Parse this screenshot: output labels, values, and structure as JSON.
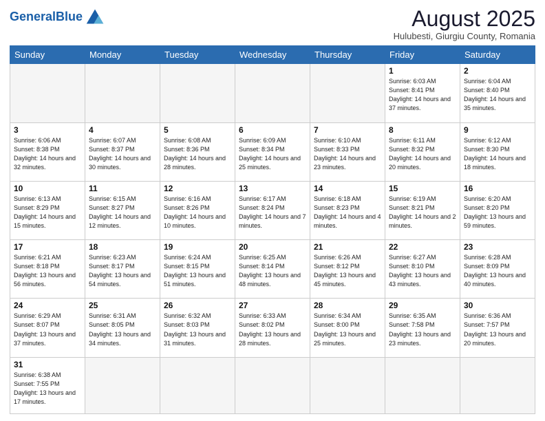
{
  "header": {
    "logo_general": "General",
    "logo_blue": "Blue",
    "month_year": "August 2025",
    "location": "Hulubesti, Giurgiu County, Romania"
  },
  "days_of_week": [
    "Sunday",
    "Monday",
    "Tuesday",
    "Wednesday",
    "Thursday",
    "Friday",
    "Saturday"
  ],
  "weeks": [
    [
      {
        "day": "",
        "info": ""
      },
      {
        "day": "",
        "info": ""
      },
      {
        "day": "",
        "info": ""
      },
      {
        "day": "",
        "info": ""
      },
      {
        "day": "",
        "info": ""
      },
      {
        "day": "1",
        "info": "Sunrise: 6:03 AM\nSunset: 8:41 PM\nDaylight: 14 hours and 37 minutes."
      },
      {
        "day": "2",
        "info": "Sunrise: 6:04 AM\nSunset: 8:40 PM\nDaylight: 14 hours and 35 minutes."
      }
    ],
    [
      {
        "day": "3",
        "info": "Sunrise: 6:06 AM\nSunset: 8:38 PM\nDaylight: 14 hours and 32 minutes."
      },
      {
        "day": "4",
        "info": "Sunrise: 6:07 AM\nSunset: 8:37 PM\nDaylight: 14 hours and 30 minutes."
      },
      {
        "day": "5",
        "info": "Sunrise: 6:08 AM\nSunset: 8:36 PM\nDaylight: 14 hours and 28 minutes."
      },
      {
        "day": "6",
        "info": "Sunrise: 6:09 AM\nSunset: 8:34 PM\nDaylight: 14 hours and 25 minutes."
      },
      {
        "day": "7",
        "info": "Sunrise: 6:10 AM\nSunset: 8:33 PM\nDaylight: 14 hours and 23 minutes."
      },
      {
        "day": "8",
        "info": "Sunrise: 6:11 AM\nSunset: 8:32 PM\nDaylight: 14 hours and 20 minutes."
      },
      {
        "day": "9",
        "info": "Sunrise: 6:12 AM\nSunset: 8:30 PM\nDaylight: 14 hours and 18 minutes."
      }
    ],
    [
      {
        "day": "10",
        "info": "Sunrise: 6:13 AM\nSunset: 8:29 PM\nDaylight: 14 hours and 15 minutes."
      },
      {
        "day": "11",
        "info": "Sunrise: 6:15 AM\nSunset: 8:27 PM\nDaylight: 14 hours and 12 minutes."
      },
      {
        "day": "12",
        "info": "Sunrise: 6:16 AM\nSunset: 8:26 PM\nDaylight: 14 hours and 10 minutes."
      },
      {
        "day": "13",
        "info": "Sunrise: 6:17 AM\nSunset: 8:24 PM\nDaylight: 14 hours and 7 minutes."
      },
      {
        "day": "14",
        "info": "Sunrise: 6:18 AM\nSunset: 8:23 PM\nDaylight: 14 hours and 4 minutes."
      },
      {
        "day": "15",
        "info": "Sunrise: 6:19 AM\nSunset: 8:21 PM\nDaylight: 14 hours and 2 minutes."
      },
      {
        "day": "16",
        "info": "Sunrise: 6:20 AM\nSunset: 8:20 PM\nDaylight: 13 hours and 59 minutes."
      }
    ],
    [
      {
        "day": "17",
        "info": "Sunrise: 6:21 AM\nSunset: 8:18 PM\nDaylight: 13 hours and 56 minutes."
      },
      {
        "day": "18",
        "info": "Sunrise: 6:23 AM\nSunset: 8:17 PM\nDaylight: 13 hours and 54 minutes."
      },
      {
        "day": "19",
        "info": "Sunrise: 6:24 AM\nSunset: 8:15 PM\nDaylight: 13 hours and 51 minutes."
      },
      {
        "day": "20",
        "info": "Sunrise: 6:25 AM\nSunset: 8:14 PM\nDaylight: 13 hours and 48 minutes."
      },
      {
        "day": "21",
        "info": "Sunrise: 6:26 AM\nSunset: 8:12 PM\nDaylight: 13 hours and 45 minutes."
      },
      {
        "day": "22",
        "info": "Sunrise: 6:27 AM\nSunset: 8:10 PM\nDaylight: 13 hours and 43 minutes."
      },
      {
        "day": "23",
        "info": "Sunrise: 6:28 AM\nSunset: 8:09 PM\nDaylight: 13 hours and 40 minutes."
      }
    ],
    [
      {
        "day": "24",
        "info": "Sunrise: 6:29 AM\nSunset: 8:07 PM\nDaylight: 13 hours and 37 minutes."
      },
      {
        "day": "25",
        "info": "Sunrise: 6:31 AM\nSunset: 8:05 PM\nDaylight: 13 hours and 34 minutes."
      },
      {
        "day": "26",
        "info": "Sunrise: 6:32 AM\nSunset: 8:03 PM\nDaylight: 13 hours and 31 minutes."
      },
      {
        "day": "27",
        "info": "Sunrise: 6:33 AM\nSunset: 8:02 PM\nDaylight: 13 hours and 28 minutes."
      },
      {
        "day": "28",
        "info": "Sunrise: 6:34 AM\nSunset: 8:00 PM\nDaylight: 13 hours and 25 minutes."
      },
      {
        "day": "29",
        "info": "Sunrise: 6:35 AM\nSunset: 7:58 PM\nDaylight: 13 hours and 23 minutes."
      },
      {
        "day": "30",
        "info": "Sunrise: 6:36 AM\nSunset: 7:57 PM\nDaylight: 13 hours and 20 minutes."
      }
    ],
    [
      {
        "day": "31",
        "info": "Sunrise: 6:38 AM\nSunset: 7:55 PM\nDaylight: 13 hours and 17 minutes."
      },
      {
        "day": "",
        "info": ""
      },
      {
        "day": "",
        "info": ""
      },
      {
        "day": "",
        "info": ""
      },
      {
        "day": "",
        "info": ""
      },
      {
        "day": "",
        "info": ""
      },
      {
        "day": "",
        "info": ""
      }
    ]
  ]
}
